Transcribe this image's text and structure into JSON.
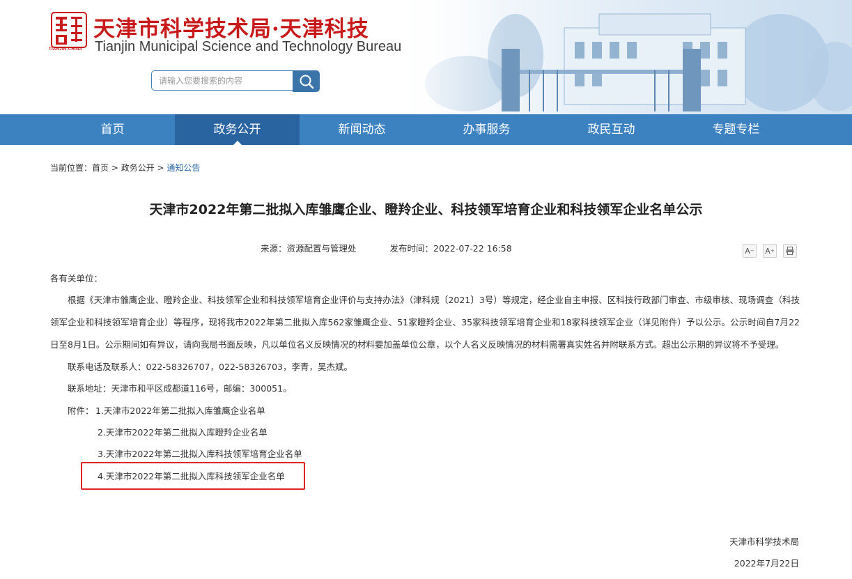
{
  "header": {
    "seal_caption": "TIANJIN·CHINA",
    "site_name_cn": "天津市科学技术局·天津科技",
    "site_name_en": "Tianjin Municipal Science and Technology Bureau",
    "search_placeholder": "请输入您要搜索的内容"
  },
  "nav": {
    "items": [
      {
        "label": "首页"
      },
      {
        "label": "政务公开"
      },
      {
        "label": "新闻动态"
      },
      {
        "label": "办事服务"
      },
      {
        "label": "政民互动"
      },
      {
        "label": "专题专栏"
      }
    ],
    "active_index": 1
  },
  "breadcrumb": {
    "prefix": "当前位置：",
    "items": [
      "首页",
      "政务公开",
      "通知公告"
    ],
    "separator": " > "
  },
  "article": {
    "title": "天津市2022年第二批拟入库雏鹰企业、瞪羚企业、科技领军培育企业和科技领军企业名单公示",
    "source_label": "来源：",
    "source": "资源配置与管理处",
    "time_label": "发布时间：",
    "time": "2022-07-22 16:58",
    "tools": {
      "font_smaller": "A",
      "font_larger": "A",
      "print": "print-icon"
    },
    "greeting": "各有关单位：",
    "main_paragraph": "根据《天津市雏鹰企业、瞪羚企业、科技领军企业和科技领军培育企业评价与支持办法》（津科规〔2021〕3号）等规定，经企业自主申报、区科技行政部门审查、市级审核、现场调查（科技领军企业和科技领军培育企业）等程序，现将我市2022年第二批拟入库562家雏鹰企业、51家瞪羚企业、35家科技领军培育企业和18家科技领军企业（详见附件）予以公示。公示时间自7月22日至8月1日。公示期间如有异议，请向我局书面反映，凡以单位名义反映情况的材料要加盖单位公章，以个人名义反映情况的材料需署真实姓名并附联系方式。超出公示期的异议将不予受理。",
    "contact": "联系电话及联系人：022-58326707，022-58326703，李青，吴杰斌。",
    "address": "联系地址：天津市和平区成都道116号，邮编：300051。",
    "attachments_label": "附件：",
    "attachments": [
      "1.天津市2022年第二批拟入库雏鹰企业名单",
      "2.天津市2022年第二批拟入库瞪羚企业名单",
      "3.天津市2022年第二批拟入库科技领军培育企业名单",
      "4.天津市2022年第二批拟入库科技领军企业名单"
    ],
    "signature_org": "天津市科学技术局",
    "signature_date": "2022年7月22日"
  },
  "colors": {
    "brand_red": "#c81a1a",
    "nav_bg": "#3c82c0",
    "nav_active": "#2a64a0",
    "highlight": "#e02424"
  }
}
